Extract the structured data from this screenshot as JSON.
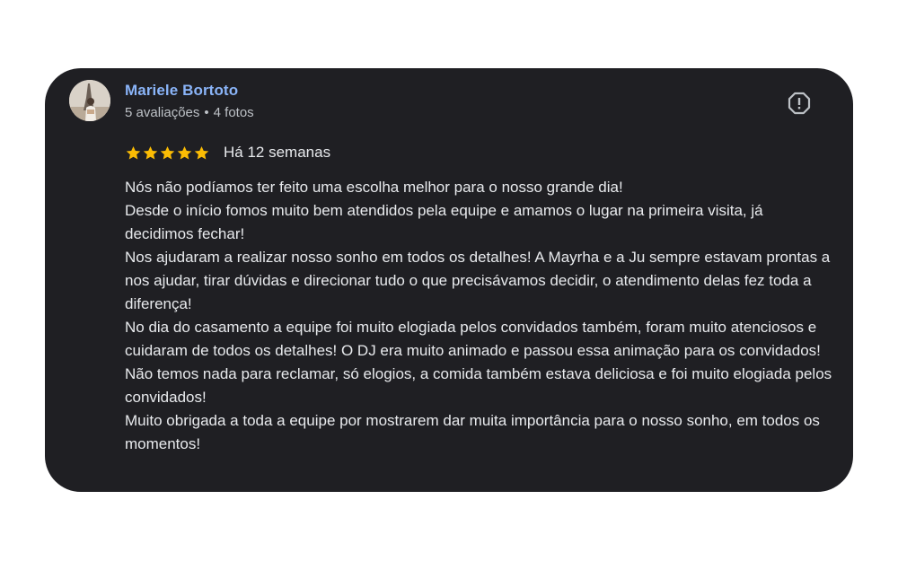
{
  "review": {
    "author": {
      "name": "Mariele Bortoto",
      "reviews_count": "5 avaliações",
      "separator": "•",
      "photos_count": "4 fotos",
      "avatar_icon": "user-photo-eiffel-tower"
    },
    "report_icon": "report-exclamation-icon",
    "rating": 5,
    "rating_max": 5,
    "date": "Há 12 semanas",
    "text": "Nós não podíamos ter feito uma escolha melhor para o nosso grande dia!\nDesde o início fomos muito bem atendidos pela equipe e amamos o lugar na primeira visita, já decidimos fechar!\nNos ajudaram a realizar nosso sonho em todos os detalhes! A Mayrha e a Ju sempre estavam prontas a nos ajudar, tirar dúvidas e direcionar tudo o que precisávamos decidir, o atendimento delas fez toda a diferença!\nNo dia do casamento a equipe foi muito elogiada pelos convidados também, foram muito atenciosos e cuidaram de todos os detalhes! O DJ era muito animado e passou essa animação para os convidados!\nNão temos nada para reclamar, só elogios, a comida também estava deliciosa e foi muito elogiada pelos convidados!\nMuito obrigada a toda a equipe por mostrarem dar muita importância para o nosso sonho, em todos os momentos!"
  },
  "colors": {
    "card_background": "#1f1f23",
    "author_name": "#8ab4f8",
    "star": "#fbbc04",
    "text": "#e8eaed",
    "meta": "#bdc1c6"
  }
}
